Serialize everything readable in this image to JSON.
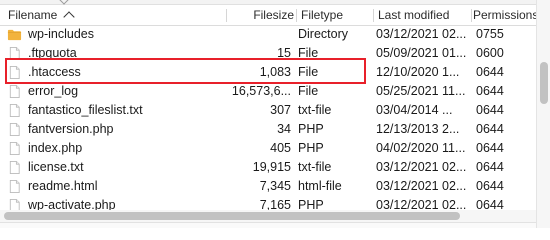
{
  "columns": {
    "filename": "Filename",
    "filesize": "Filesize",
    "filetype": "Filetype",
    "modified": "Last modified",
    "permissions": "Permissions"
  },
  "rows": [
    {
      "name": "wp-includes",
      "size": "",
      "type": "Directory",
      "modified": "03/12/2021 02...",
      "perms": "0755",
      "icon": "folder-icon"
    },
    {
      "name": ".ftpquota",
      "size": "15",
      "type": "File",
      "modified": "05/09/2021 01...",
      "perms": "0600",
      "icon": "file-icon"
    },
    {
      "name": ".htaccess",
      "size": "1,083",
      "type": "File",
      "modified": "12/10/2020 1...",
      "perms": "0644",
      "icon": "file-icon"
    },
    {
      "name": "error_log",
      "size": "16,573,6...",
      "type": "File",
      "modified": "05/25/2021 11...",
      "perms": "0644",
      "icon": "file-icon"
    },
    {
      "name": "fantastico_fileslist.txt",
      "size": "307",
      "type": "txt-file",
      "modified": "03/04/2014 ...",
      "perms": "0644",
      "icon": "file-icon"
    },
    {
      "name": "fantversion.php",
      "size": "34",
      "type": "PHP",
      "modified": "12/13/2013 2...",
      "perms": "0644",
      "icon": "file-icon"
    },
    {
      "name": "index.php",
      "size": "405",
      "type": "PHP",
      "modified": "04/02/2020 11...",
      "perms": "0644",
      "icon": "file-icon"
    },
    {
      "name": "license.txt",
      "size": "19,915",
      "type": "txt-file",
      "modified": "03/12/2021 02...",
      "perms": "0644",
      "icon": "file-icon"
    },
    {
      "name": "readme.html",
      "size": "7,345",
      "type": "html-file",
      "modified": "03/12/2021 02...",
      "perms": "0644",
      "icon": "file-icon"
    },
    {
      "name": "wp-activate.php",
      "size": "7,165",
      "type": "PHP",
      "modified": "03/12/2021 02...",
      "perms": "0644",
      "icon": "file-icon"
    }
  ],
  "highlighted_row": ".htaccess",
  "colors": {
    "highlight": "#e8202a",
    "folder": "#f2b33d"
  }
}
